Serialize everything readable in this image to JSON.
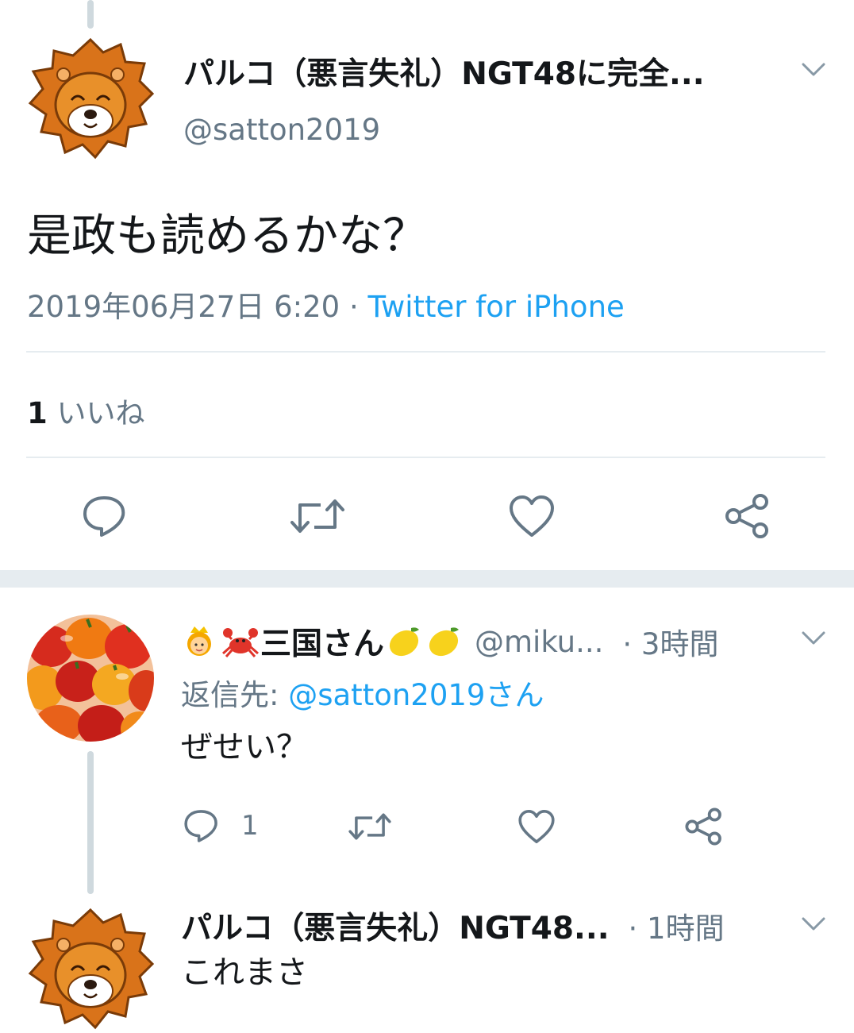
{
  "main_tweet": {
    "display_name": "パルコ（悪言失礼）NGT48に完全...",
    "handle": "@satton2019",
    "text": "是政も読めるかな？",
    "date": "2019年06月27日 6:20",
    "separator": "·",
    "source": "Twitter for iPhone",
    "likes_count": "1",
    "likes_label": "いいね",
    "avatar_icon": "lion-avatar"
  },
  "reply_1": {
    "display_name": "三国さん",
    "emoji_prefix": [
      "princess-emoji",
      "crab-emoji"
    ],
    "emoji_suffix": [
      "lemon-emoji",
      "lemon-emoji"
    ],
    "handle": "@miku...",
    "time": "· 3時間",
    "replying_to_label": "返信先: ",
    "replying_to_handle": "@satton2019さん",
    "text": "ぜせい？",
    "reply_count": "1",
    "avatar_icon": "bell-peppers-avatar"
  },
  "reply_2": {
    "display_name": "パルコ（悪言失礼）NGT48...",
    "time": "· 1時間",
    "text": "これまさ",
    "avatar_icon": "lion-avatar"
  },
  "colors": {
    "accent": "#1da1f2",
    "muted": "#657786",
    "text": "#14171a",
    "divider": "#e6ecf0",
    "section_gap": "#e6ecf0"
  }
}
